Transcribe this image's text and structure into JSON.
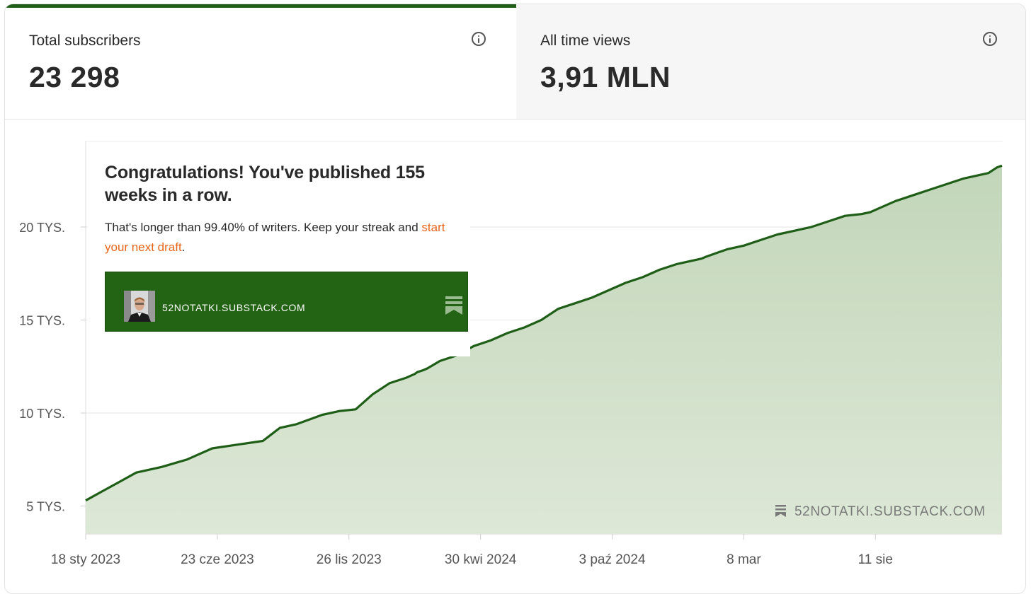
{
  "stats": {
    "subscribers": {
      "label": "Total subscribers",
      "value": "23 298"
    },
    "views": {
      "label": "All time views",
      "value": "3,91 MLN"
    }
  },
  "popup": {
    "title": "Congratulations! You've published 155 weeks in a row.",
    "text_before": "That's longer than 99.40% of writers. Keep your streak and ",
    "link": "start your next draft",
    "text_after": ".",
    "banner_domain": "52NOTATKI.SUBSTACK.COM"
  },
  "watermark": "52NOTATKI.SUBSTACK.COM",
  "colors": {
    "accent": "#1e5e16",
    "fill": "#cddcc6",
    "link": "#e8651a"
  },
  "chart_data": {
    "type": "area",
    "ylim": [
      3500,
      24600
    ],
    "yticks": [
      {
        "value": 5000,
        "label": "5 TYS."
      },
      {
        "value": 10000,
        "label": "10 TYS."
      },
      {
        "value": 15000,
        "label": "15 TYS."
      },
      {
        "value": 20000,
        "label": "20 TYS."
      }
    ],
    "xticks": [
      {
        "value": 0,
        "label": "18 sty 2023"
      },
      {
        "value": 156,
        "label": "23 cze 2023"
      },
      {
        "value": 312,
        "label": "26 lis 2023"
      },
      {
        "value": 468,
        "label": "30 kwi 2024"
      },
      {
        "value": 624,
        "label": "3 paź 2024"
      },
      {
        "value": 780,
        "label": "8 mar"
      },
      {
        "value": 936,
        "label": "11 sie"
      }
    ],
    "xlim": [
      0,
      1086
    ],
    "series": [
      {
        "x": [
          0,
          20,
          40,
          60,
          90,
          120,
          150,
          180,
          210,
          230,
          250,
          280,
          300,
          320,
          340,
          360,
          380,
          390,
          393,
          400,
          405,
          420,
          440,
          460,
          480,
          500,
          520,
          540,
          560,
          580,
          600,
          620,
          640,
          660,
          680,
          700,
          720,
          730,
          735,
          760,
          780,
          800,
          820,
          840,
          860,
          880,
          900,
          920,
          930,
          940,
          960,
          980,
          1000,
          1020,
          1040,
          1060,
          1070,
          1080,
          1086
        ],
        "y": [
          5300,
          5800,
          6300,
          6800,
          7100,
          7500,
          8100,
          8300,
          8500,
          9200,
          9400,
          9900,
          10100,
          10200,
          11000,
          11600,
          11900,
          12100,
          12200,
          12300,
          12400,
          12800,
          13100,
          13600,
          13900,
          14300,
          14600,
          15000,
          15600,
          15900,
          16200,
          16600,
          17000,
          17300,
          17700,
          18000,
          18200,
          18300,
          18400,
          18800,
          19000,
          19300,
          19600,
          19800,
          20000,
          20300,
          20600,
          20700,
          20800,
          21000,
          21400,
          21700,
          22000,
          22300,
          22600,
          22800,
          22900,
          23200,
          23300
        ]
      }
    ]
  }
}
